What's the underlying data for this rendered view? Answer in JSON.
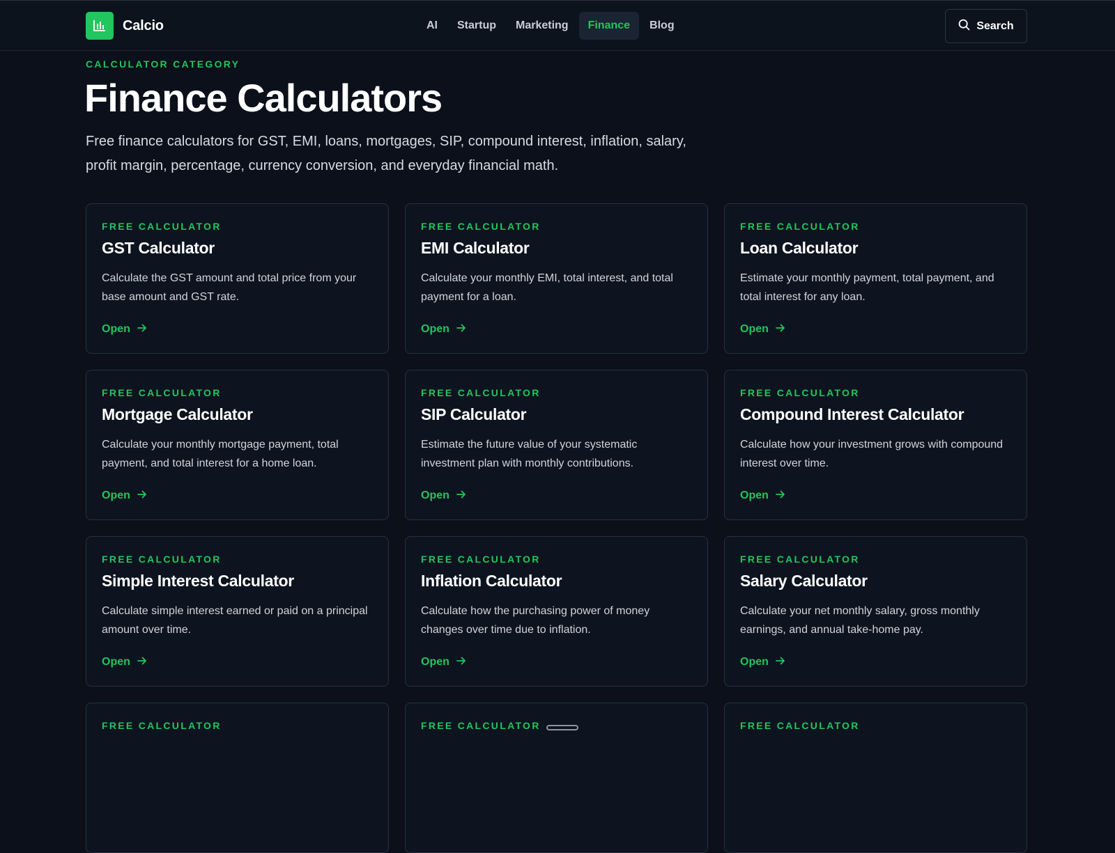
{
  "header": {
    "brand": "Calcio",
    "nav": [
      {
        "label": "AI",
        "active": false
      },
      {
        "label": "Startup",
        "active": false
      },
      {
        "label": "Marketing",
        "active": false
      },
      {
        "label": "Finance",
        "active": true
      },
      {
        "label": "Blog",
        "active": false
      }
    ],
    "search_label": "Search"
  },
  "hero": {
    "eyebrow": "CALCULATOR CATEGORY",
    "title": "Finance Calculators",
    "description": "Free finance calculators for GST, EMI, loans, mortgages, SIP, compound interest, inflation, salary, profit margin, percentage, currency conversion, and everyday financial math."
  },
  "cards": [
    {
      "tag": "FREE CALCULATOR",
      "title": "GST Calculator",
      "desc": "Calculate the GST amount and total price from your base amount and GST rate.",
      "open": "Open"
    },
    {
      "tag": "FREE CALCULATOR",
      "title": "EMI Calculator",
      "desc": "Calculate your monthly EMI, total interest, and total payment for a loan.",
      "open": "Open"
    },
    {
      "tag": "FREE CALCULATOR",
      "title": "Loan Calculator",
      "desc": "Estimate your monthly payment, total payment, and total interest for any loan.",
      "open": "Open"
    },
    {
      "tag": "FREE CALCULATOR",
      "title": "Mortgage Calculator",
      "desc": "Calculate your monthly mortgage payment, total payment, and total interest for a home loan.",
      "open": "Open"
    },
    {
      "tag": "FREE CALCULATOR",
      "title": "SIP Calculator",
      "desc": "Estimate the future value of your systematic investment plan with monthly contributions.",
      "open": "Open"
    },
    {
      "tag": "FREE CALCULATOR",
      "title": "Compound Interest Calculator",
      "desc": "Calculate how your investment grows with compound interest over time.",
      "open": "Open"
    },
    {
      "tag": "FREE CALCULATOR",
      "title": "Simple Interest Calculator",
      "desc": "Calculate simple interest earned or paid on a principal amount over time.",
      "open": "Open"
    },
    {
      "tag": "FREE CALCULATOR",
      "title": "Inflation Calculator",
      "desc": "Calculate how the purchasing power of money changes over time due to inflation.",
      "open": "Open"
    },
    {
      "tag": "FREE CALCULATOR",
      "title": "Salary Calculator",
      "desc": "Calculate your net monthly salary, gross monthly earnings, and annual take-home pay.",
      "open": "Open"
    },
    {
      "tag": "FREE CALCULATOR",
      "title": "",
      "desc": "",
      "open": ""
    },
    {
      "tag": "FREE CALCULATOR",
      "title": "",
      "desc": "",
      "open": ""
    },
    {
      "tag": "FREE CALCULATOR",
      "title": "",
      "desc": "",
      "open": ""
    }
  ],
  "icons": {
    "logo": "bar-chart-icon",
    "search": "search-icon",
    "open": "arrow-right-icon"
  },
  "colors": {
    "accent": "#22c55e",
    "background": "#0b101a",
    "card": "#0e141f"
  }
}
